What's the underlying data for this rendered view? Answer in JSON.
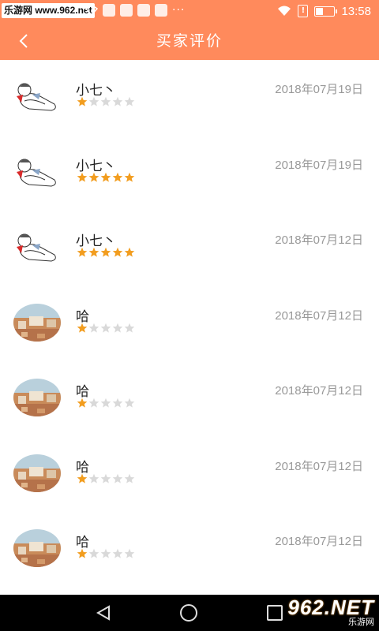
{
  "status_bar": {
    "watermark": "乐游网 www.962.net",
    "dots": "···",
    "alert": "!",
    "time": "13:58"
  },
  "app_bar": {
    "title": "买家评价"
  },
  "reviews": [
    {
      "name": "小七丶",
      "date": "2018年07月19日",
      "rating": 1,
      "avatar": "cartoon-man"
    },
    {
      "name": "小七丶",
      "date": "2018年07月19日",
      "rating": 5,
      "avatar": "cartoon-man"
    },
    {
      "name": "小七丶",
      "date": "2018年07月12日",
      "rating": 5,
      "avatar": "cartoon-man"
    },
    {
      "name": "哈",
      "date": "2018年07月12日",
      "rating": 1,
      "avatar": "city-photo"
    },
    {
      "name": "哈",
      "date": "2018年07月12日",
      "rating": 1,
      "avatar": "city-photo"
    },
    {
      "name": "哈",
      "date": "2018年07月12日",
      "rating": 1,
      "avatar": "city-photo"
    },
    {
      "name": "哈",
      "date": "2018年07月12日",
      "rating": 1,
      "avatar": "city-photo"
    }
  ],
  "colors": {
    "accent": "#ff8a5c",
    "star_on": "#f29d1f",
    "star_off": "#d9d9d9"
  },
  "nav_watermark": {
    "brand": "962.NET",
    "caption": "乐游网"
  }
}
